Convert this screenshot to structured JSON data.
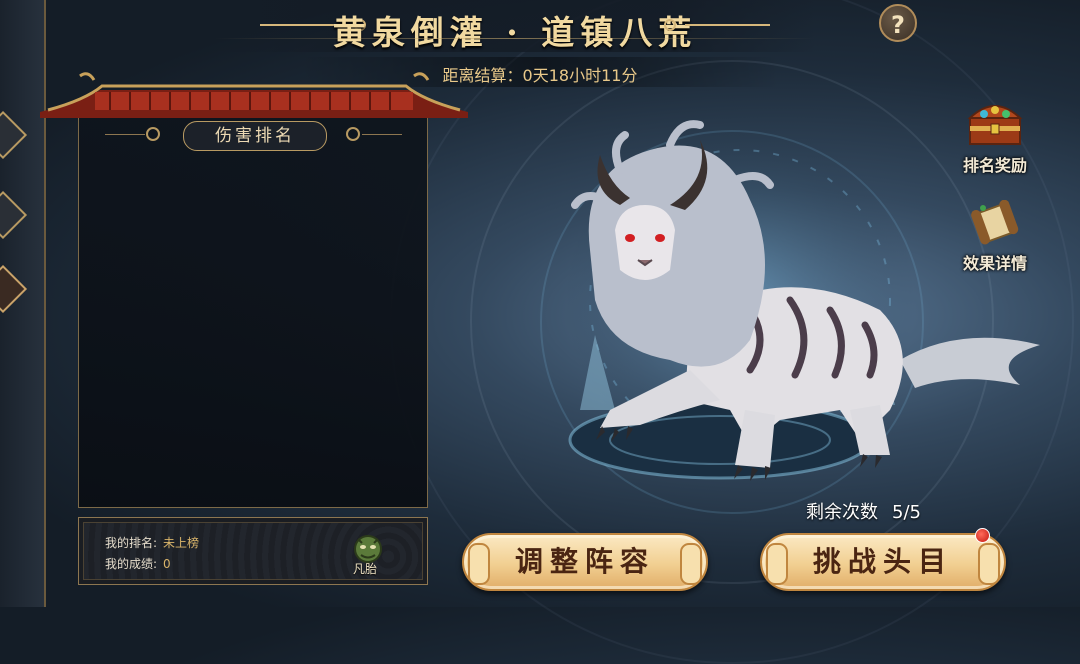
{
  "header": {
    "title": "黄泉倒灌 · 道镇八荒",
    "countdown_label": "距离结算：",
    "countdown_value": "0天18小时11分",
    "help_symbol": "?"
  },
  "ranking_panel": {
    "heading": "伤害排名"
  },
  "my_status": {
    "rank_label": "我的排名:",
    "rank_value": "未上榜",
    "score_label": "我的成绩:",
    "score_value": "0",
    "badge_label": "凡胎"
  },
  "side_buttons": {
    "rank_rewards": "排名奖励",
    "effect_details": "效果详情"
  },
  "battle": {
    "remaining_label": "剩余次数",
    "remaining_value": "5/5",
    "adjust_lineup": "调整阵容",
    "challenge_boss": "挑战头目"
  },
  "icons": {
    "help": "question-icon",
    "rewards": "treasure-chest-icon",
    "details": "scroll-icon",
    "badge": "demon-mask-icon",
    "notification": "red-dot-icon"
  },
  "colors": {
    "title_gold": "#f1d9a0",
    "button_gold": "#f1cf91",
    "button_text": "#4a2512",
    "roof_red": "#a8301f",
    "notification_red": "#c41810"
  }
}
